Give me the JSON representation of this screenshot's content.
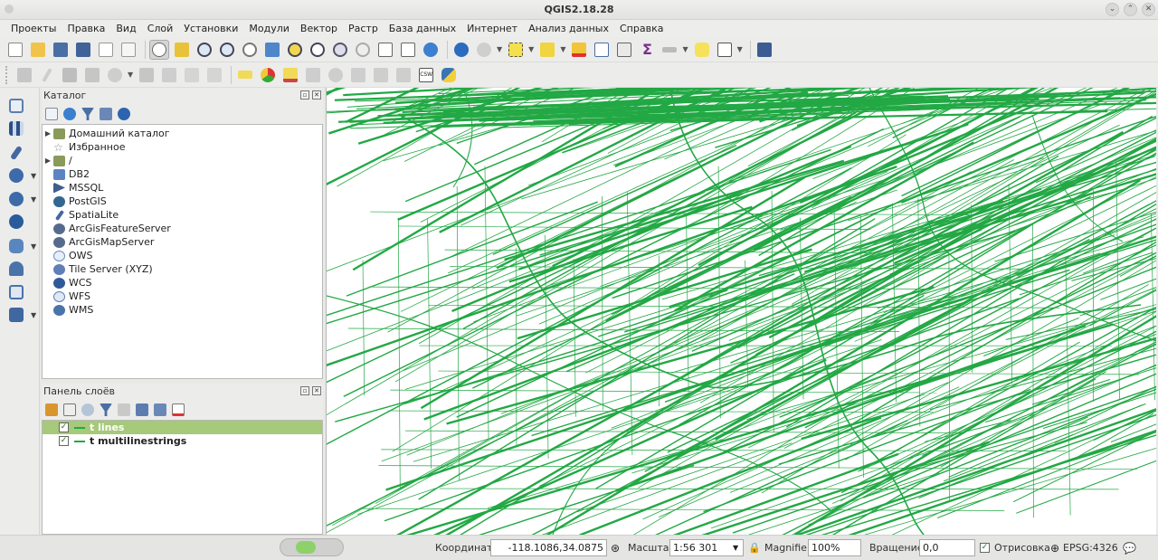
{
  "window": {
    "title": "QGIS2.18.28"
  },
  "menu": [
    {
      "label": "Проекты"
    },
    {
      "label": "Правка"
    },
    {
      "label": "Вид"
    },
    {
      "label": "Слой"
    },
    {
      "label": "Установки"
    },
    {
      "label": "Модули"
    },
    {
      "label": "Вектор"
    },
    {
      "label": "Растр"
    },
    {
      "label": "База данных"
    },
    {
      "label": "Интернет"
    },
    {
      "label": "Анализ данных"
    },
    {
      "label": "Справка"
    }
  ],
  "toolbar_icons": {
    "row1": [
      "new-project-icon",
      "open-project-icon",
      "save-project-icon",
      "save-as-icon",
      "new-print-composer-icon",
      "composer-manager-icon",
      "pan-map-icon",
      "pan-to-selection-icon",
      "zoom-in-icon",
      "zoom-out-icon",
      "zoom-actual-icon",
      "zoom-full-icon",
      "zoom-to-selection-icon",
      "zoom-to-layer-icon",
      "zoom-last-icon",
      "zoom-next-icon",
      "new-bookmark-icon",
      "show-bookmarks-icon",
      "refresh-icon",
      "identify-icon",
      "run-action-icon",
      "select-features-icon",
      "select-by-expression-icon",
      "deselect-icon",
      "attribute-table-icon",
      "field-calculator-icon",
      "statistics-icon",
      "measure-icon",
      "map-tips-icon",
      "text-annotation-icon",
      "help-icon"
    ],
    "row2": [
      "digitize-icon",
      "edit-pencil-icon",
      "save-edits-icon",
      "add-feature-icon",
      "node-tool-icon",
      "delete-selected-icon",
      "cut-features-icon",
      "copy-features-icon",
      "paste-features-icon",
      "label-icon",
      "diagram-icon",
      "layer-labeling-icon",
      "pin-labels-icon",
      "show-hide-labels-icon",
      "move-label-icon",
      "rotate-label-icon",
      "change-label-icon",
      "csw-icon",
      "python-console-icon"
    ]
  },
  "catalog": {
    "title": "Каталог",
    "items": [
      {
        "label": "Домашний каталог",
        "icon": "folder-icon",
        "expandable": true
      },
      {
        "label": "Избранное",
        "icon": "star-icon",
        "expandable": false
      },
      {
        "label": "/",
        "icon": "folder-icon",
        "expandable": true
      },
      {
        "label": "DB2",
        "icon": "db2-icon",
        "expandable": false
      },
      {
        "label": "MSSQL",
        "icon": "mssql-icon",
        "expandable": false
      },
      {
        "label": "PostGIS",
        "icon": "postgis-icon",
        "expandable": false
      },
      {
        "label": "SpatiaLite",
        "icon": "spatialite-icon",
        "expandable": false
      },
      {
        "label": "ArcGisFeatureServer",
        "icon": "arcgis-feature-icon",
        "expandable": false
      },
      {
        "label": "ArcGisMapServer",
        "icon": "arcgis-map-icon",
        "expandable": false
      },
      {
        "label": "OWS",
        "icon": "ows-icon",
        "expandable": false
      },
      {
        "label": "Tile Server (XYZ)",
        "icon": "tile-server-icon",
        "expandable": false
      },
      {
        "label": "WCS",
        "icon": "wcs-icon",
        "expandable": false
      },
      {
        "label": "WFS",
        "icon": "wfs-icon",
        "expandable": false
      },
      {
        "label": "WMS",
        "icon": "wms-icon",
        "expandable": false
      }
    ]
  },
  "layers_panel": {
    "title": "Панель слоёв",
    "layers": [
      {
        "name": "t lines",
        "checked": true,
        "selected": true
      },
      {
        "name": "t multilinestrings",
        "checked": true,
        "selected": false
      }
    ]
  },
  "map": {
    "line_color": "#22a844"
  },
  "status": {
    "coordinates_label": "Координаты",
    "coordinates_value": "-118.1086,34.0875",
    "scale_label": "Масштаб",
    "scale_value": "1:56 301",
    "magnifier_label": "Magnifier",
    "magnifier_value": "100%",
    "rotation_label": "Вращение",
    "rotation_value": "0,0",
    "render_label": "Отрисовка",
    "crs_label": "EPSG:4326"
  }
}
